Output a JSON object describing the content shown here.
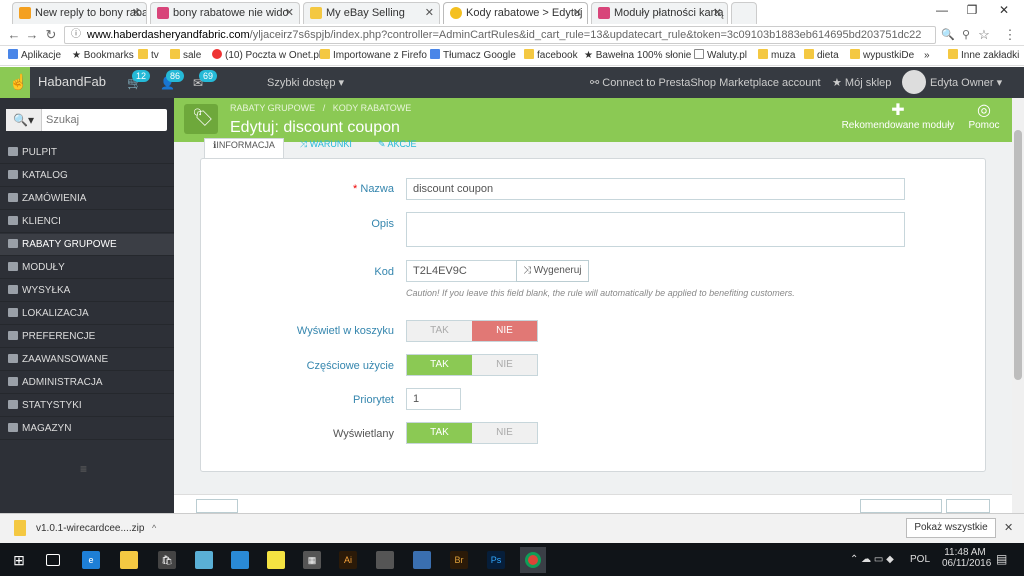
{
  "browser": {
    "tabs": [
      {
        "label": "New reply to bony rabat",
        "color": "#f4a020",
        "active": false
      },
      {
        "label": "bony rabatowe nie wido",
        "color": "#d8457a",
        "active": false
      },
      {
        "label": "My eBay Selling",
        "color": "#f4c842",
        "active": false
      },
      {
        "label": "Kody rabatowe > Edytuj",
        "color": "#f4c020",
        "active": true
      },
      {
        "label": "Moduły płatności kartą",
        "color": "#d8457a",
        "active": false
      }
    ],
    "window_controls": {
      "minimize": "—",
      "restore": "❐",
      "close": "✕"
    },
    "url_domain": "www.haberdasheryandfabric.com",
    "url_path": "/yljaceirz7s6spjb/index.php?controller=AdminCartRules&id_cart_rule=13&updatecart_rule&token=3c09103b1883eb614695bd203751dc22",
    "bookmarks": [
      {
        "label": "Aplikacje",
        "icon": "grid-icon"
      },
      {
        "label": "Bookmarks",
        "icon": "star-icon"
      },
      {
        "label": "tv",
        "icon": "folder-icon"
      },
      {
        "label": "sale",
        "icon": "folder-icon"
      },
      {
        "label": "(10) Poczta w Onet.pl",
        "icon": "onet-icon"
      },
      {
        "label": "Importowane z Firefo",
        "icon": "folder-icon"
      },
      {
        "label": "Tłumacz Google",
        "icon": "translate-icon"
      },
      {
        "label": "facebook",
        "icon": "folder-icon"
      },
      {
        "label": "Bawełna 100% słonie",
        "icon": "star-icon"
      },
      {
        "label": "Waluty.pl",
        "icon": "page-icon"
      },
      {
        "label": "muza",
        "icon": "folder-icon"
      },
      {
        "label": "dieta",
        "icon": "folder-icon"
      },
      {
        "label": "wypustkiDe",
        "icon": "folder-icon"
      },
      {
        "label": "»",
        "icon": ""
      },
      {
        "label": "Inne zakładki",
        "icon": "folder-icon"
      }
    ]
  },
  "admin": {
    "shop_name": "HabandFab",
    "badges": {
      "orders": "12",
      "customers": "86",
      "messages": "69"
    },
    "quick_access": "Szybki dostęp",
    "connect_label": "Connect to PrestaShop Marketplace account",
    "my_shop": "Mój sklep",
    "user": "Edyta Owner",
    "search_placeholder": "Szukaj",
    "nav": [
      {
        "label": "PULPIT",
        "active": false
      },
      {
        "label": "KATALOG",
        "active": false
      },
      {
        "label": "ZAMÓWIENIA",
        "active": false
      },
      {
        "label": "KLIENCI",
        "active": false
      },
      {
        "label": "RABATY GRUPOWE",
        "active": true
      },
      {
        "label": "MODUŁY",
        "active": false
      },
      {
        "label": "WYSYŁKA",
        "active": false
      },
      {
        "label": "LOKALIZACJA",
        "active": false
      },
      {
        "label": "PREFERENCJE",
        "active": false
      },
      {
        "label": "ZAAWANSOWANE",
        "active": false
      },
      {
        "label": "ADMINISTRACJA",
        "active": false
      },
      {
        "label": "STATYSTYKI",
        "active": false
      },
      {
        "label": "MAGAZYN",
        "active": false
      }
    ],
    "breadcrumb": [
      "RABATY GRUPOWE",
      "KODY RABATOWE"
    ],
    "page_title": "Edytuj: discount coupon",
    "header_actions": {
      "recommended": "Rekomendowane moduły",
      "help": "Pomoc"
    }
  },
  "form": {
    "tabs": [
      "INFORMACJA",
      "WARUNKI",
      "AKCJE"
    ],
    "name_label": "Nazwa",
    "name_value": "discount coupon",
    "desc_label": "Opis",
    "desc_value": "",
    "code_label": "Kod",
    "code_value": "T2L4EV9C",
    "generate_label": "Wygeneruj",
    "code_help": "Caution! If you leave this field blank, the rule will automatically be applied to benefiting customers.",
    "show_in_cart_label": "Wyświetl w koszyku",
    "partial_use_label": "Częściowe użycie",
    "priority_label": "Priorytet",
    "priority_value": "1",
    "active_label": "Wyświetlany",
    "yes": "TAK",
    "no": "NIE",
    "show_in_cart": false,
    "partial_use": true,
    "active": true
  },
  "downloads": {
    "file": "v1.0.1-wirecardcee....zip",
    "show_all": "Pokaż wszystkie"
  },
  "taskbar": {
    "time": "11:48 AM",
    "date": "06/11/2016",
    "lang": "POL"
  }
}
